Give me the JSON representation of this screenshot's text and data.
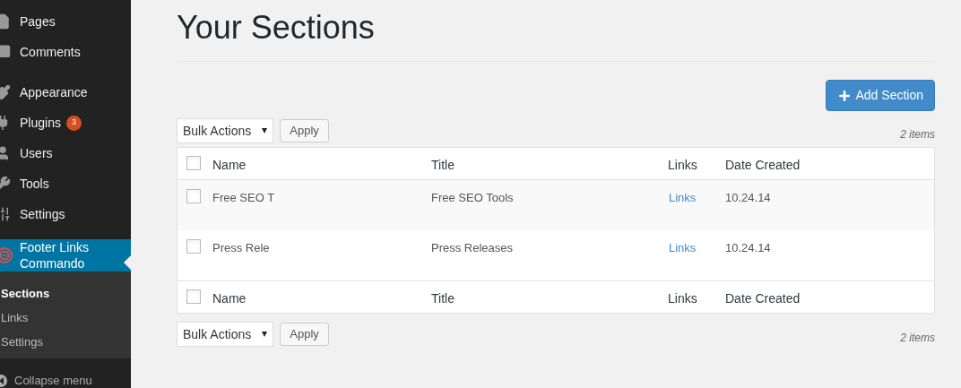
{
  "sidebar": {
    "groups": [
      [
        {
          "label": "Pages"
        },
        {
          "label": "Comments"
        }
      ],
      [
        {
          "label": "Appearance"
        },
        {
          "label": "Plugins",
          "badge": "3"
        },
        {
          "label": "Users"
        },
        {
          "label": "Tools"
        },
        {
          "label": "Settings"
        }
      ]
    ],
    "active": {
      "label": "Footer Links Commando"
    },
    "submenu": [
      {
        "label": "Sections",
        "selected": true
      },
      {
        "label": "Links",
        "selected": false
      },
      {
        "label": "Settings",
        "selected": false
      }
    ],
    "collapse": "Collapse menu"
  },
  "title": "Your Sections",
  "add_button": "Add Section",
  "top_nav": {
    "bulk": "Bulk Actions",
    "apply": "Apply",
    "count": "2 items"
  },
  "table": {
    "header_checked": false,
    "footer_checked": false,
    "columns": [
      "Name",
      "Title",
      "Links",
      "Date Created"
    ],
    "rows": [
      {
        "name": "Free SEO T",
        "title": "Free SEO Tools",
        "links": "Links",
        "date": "10.24.14",
        "checked": false
      },
      {
        "name": "Press Rele",
        "title": "Press Releases",
        "links": "Links",
        "date": "10.24.14",
        "checked": false
      }
    ],
    "footer_columns": [
      "Name",
      "Title",
      "Links",
      "Date Created"
    ]
  },
  "bottom_nav": {
    "bulk": "Bulk Actions",
    "apply": "Apply",
    "count": "2 items"
  }
}
